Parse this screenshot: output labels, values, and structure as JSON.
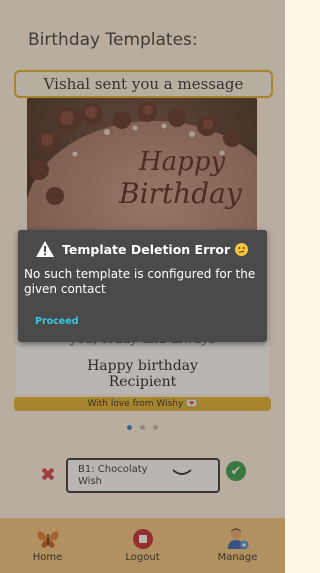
{
  "page": {
    "heading": "Birthday Templates:"
  },
  "card": {
    "banner": "Vishal sent you a message",
    "cut_line": "you, today and always",
    "greeting_line1": "Happy birthday",
    "greeting_line2": "Recipient",
    "footer": "With love from Wishy 💌"
  },
  "carousel": {
    "count": 3,
    "active_index": 0
  },
  "template_select": {
    "value": "B1: Chocolaty Wish"
  },
  "nav": {
    "items": [
      {
        "label": "Home",
        "icon": "butterfly-icon"
      },
      {
        "label": "Logout",
        "icon": "logout-icon"
      },
      {
        "label": "Manage",
        "icon": "manage-user-icon"
      }
    ]
  },
  "dialog": {
    "title": "Template Deletion Error",
    "message": "No such template is configured for the given contact",
    "action": "Proceed"
  },
  "colors": {
    "banner_border": "#e0b12a",
    "footer_bar": "#e2b22e",
    "bottom_nav": "#f3c57b",
    "dialog_bg": "#4a4a4a",
    "dialog_action": "#36c9e0",
    "confirm": "#2e9f46",
    "cancel": "#d43a4a"
  }
}
